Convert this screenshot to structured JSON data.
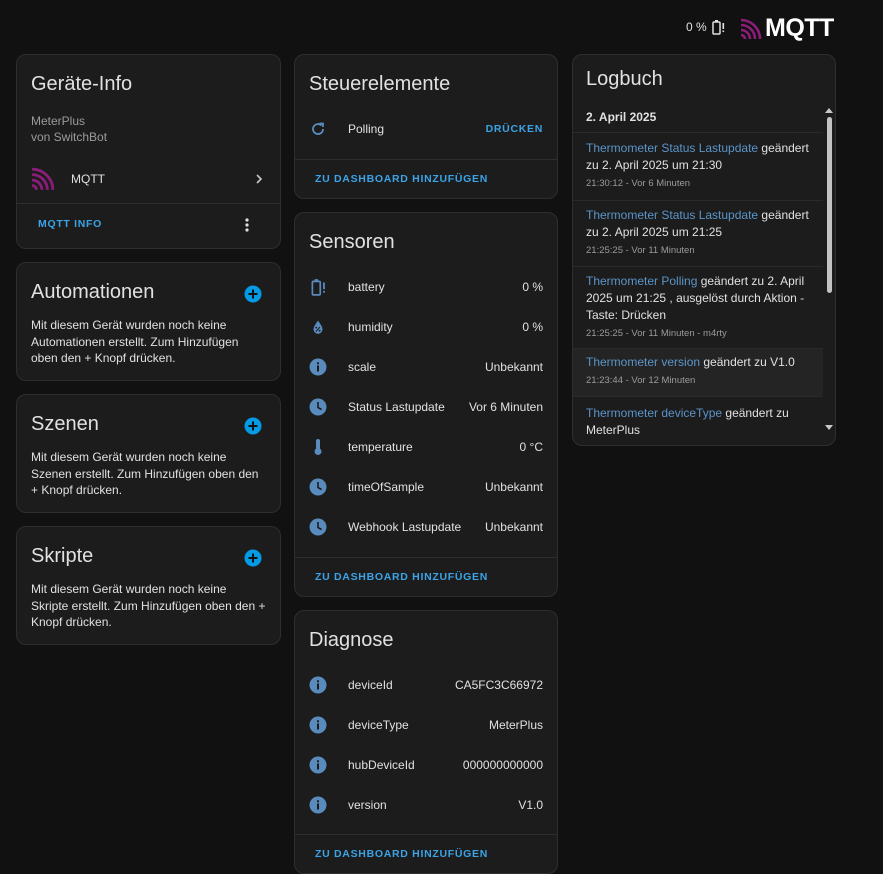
{
  "header": {
    "battery_text": "0 %",
    "brand": "MQTT",
    "brand_color": "#8b1c7a"
  },
  "device_info": {
    "title": "Geräte-Info",
    "model": "MeterPlus",
    "manufacturer": "von SwitchBot",
    "integration": "MQTT",
    "info_button": "MQTT INFO"
  },
  "automations": {
    "title": "Automationen",
    "text": "Mit diesem Gerät wurden noch keine Automationen erstellt. Zum Hinzufügen oben den + Knopf drücken."
  },
  "scenes": {
    "title": "Szenen",
    "text": "Mit diesem Gerät wurden noch keine Szenen erstellt. Zum Hinzufügen oben den + Knopf drücken."
  },
  "scripts": {
    "title": "Skripte",
    "text": "Mit diesem Gerät wurden noch keine Skripte erstellt. Zum Hinzufügen oben den + Knopf drücken."
  },
  "controls": {
    "title": "Steuerelemente",
    "rows": [
      {
        "label": "Polling",
        "action": "DRÜCKEN",
        "icon": "refresh-icon"
      }
    ],
    "add_dashboard": "ZU DASHBOARD HINZUFÜGEN"
  },
  "sensors": {
    "title": "Sensoren",
    "rows": [
      {
        "label": "battery",
        "value": "0 %",
        "icon": "battery-alert-icon"
      },
      {
        "label": "humidity",
        "value": "0 %",
        "icon": "water-percent-icon"
      },
      {
        "label": "scale",
        "value": "Unbekannt",
        "icon": "info-icon"
      },
      {
        "label": "Status Lastupdate",
        "value": "Vor 6 Minuten",
        "icon": "clock-icon"
      },
      {
        "label": "temperature",
        "value": "0 °C",
        "icon": "thermometer-icon"
      },
      {
        "label": "timeOfSample",
        "value": "Unbekannt",
        "icon": "clock-icon"
      },
      {
        "label": "Webhook Lastupdate",
        "value": "Unbekannt",
        "icon": "clock-icon"
      }
    ],
    "add_dashboard": "ZU DASHBOARD HINZUFÜGEN"
  },
  "diagnostics": {
    "title": "Diagnose",
    "rows": [
      {
        "label": "deviceId",
        "value": "CA5FC3C66972",
        "icon": "info-icon"
      },
      {
        "label": "deviceType",
        "value": "MeterPlus",
        "icon": "info-icon"
      },
      {
        "label": "hubDeviceId",
        "value": "000000000000",
        "icon": "info-icon"
      },
      {
        "label": "version",
        "value": "V1.0",
        "icon": "info-icon"
      }
    ],
    "add_dashboard": "ZU DASHBOARD HINZUFÜGEN"
  },
  "logbook": {
    "title": "Logbuch",
    "date": "2. April 2025",
    "entries": [
      {
        "entity": "Thermometer Status Lastupdate",
        "text": " geändert zu 2. April 2025 um 21:30",
        "time": "21:30:12 - Vor 6 Minuten"
      },
      {
        "entity": "Thermometer Status Lastupdate",
        "text": " geändert zu 2. April 2025 um 21:25",
        "time": "21:25:25 - Vor 11 Minuten"
      },
      {
        "entity": "Thermometer Polling",
        "text": " geändert zu 2. April 2025 um 21:25 , ausgelöst durch Aktion - Taste: Drücken",
        "time": "21:25:25 - Vor 11 Minuten - m4rty"
      },
      {
        "entity": "Thermometer version",
        "text": " geändert zu V1.0",
        "time": "21:23:44 - Vor 12 Minuten"
      },
      {
        "entity": "Thermometer deviceType",
        "text": " geändert zu MeterPlus",
        "time": ""
      }
    ]
  },
  "colors": {
    "accent": "#3ba3e6",
    "icon": "#5a8bbd",
    "card": "#1c1c1c",
    "background": "#111111"
  }
}
